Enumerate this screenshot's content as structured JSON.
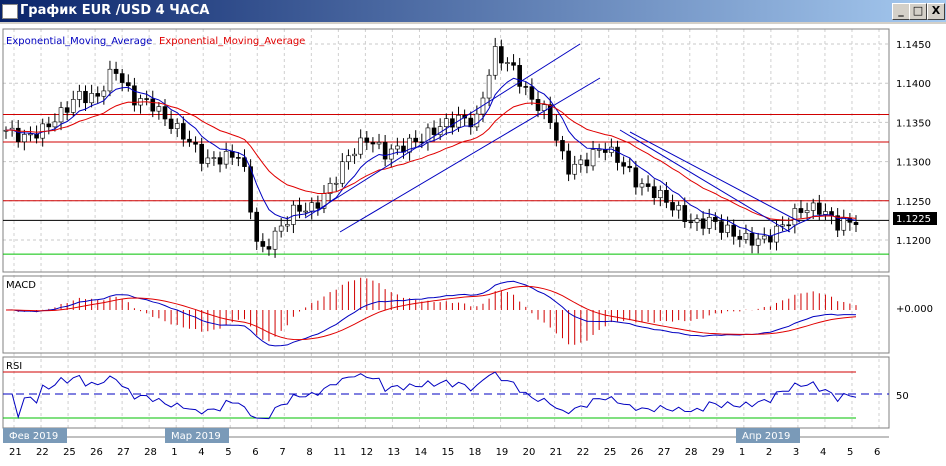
{
  "window": {
    "title": "График EUR /USD  4 ЧАСА",
    "minimize": "_",
    "maximize": "□",
    "close": "X"
  },
  "legend": {
    "ema_blue": "Exponential_Moving_Average",
    "ema_red": "Exponential_Moving_Average"
  },
  "colors": {
    "up": "#ffffff",
    "down": "#000000",
    "ema_fast": "#0000c0",
    "ema_slow": "#e00000",
    "level_red": "#d00000",
    "level_green": "#00c000"
  },
  "price_axis": {
    "labels": [
      "1.1450",
      "1.1400",
      "1.1350",
      "1.1300",
      "1.1250",
      "1.1200"
    ],
    "current": "1.1225"
  },
  "macd": {
    "label": "MACD",
    "axis_label": "+0.000"
  },
  "rsi": {
    "label": "RSI",
    "axis_label": "50"
  },
  "months": [
    "Фев 2019",
    "Мар 2019",
    "Апр 2019"
  ],
  "dates": [
    "21",
    "22",
    "25",
    "26",
    "27",
    "28",
    "1",
    "4",
    "5",
    "6",
    "7",
    "8",
    "11",
    "12",
    "13",
    "14",
    "15",
    "18",
    "19",
    "20",
    "21",
    "22",
    "25",
    "26",
    "27",
    "28",
    "29",
    "1",
    "2",
    "3",
    "4",
    "5",
    "6"
  ],
  "chart_data": {
    "type": "candlestick",
    "levels": {
      "red": [
        1.136,
        1.1325,
        1.125
      ],
      "black": 1.1225,
      "green": 1.1182
    },
    "ylim": [
      1.1172,
      1.147
    ],
    "closes": [
      1.134,
      1.133,
      1.134,
      1.136,
      1.1385,
      1.138,
      1.142,
      1.138,
      1.1375,
      1.135,
      1.133,
      1.13,
      1.1305,
      1.131,
      1.118,
      1.121,
      1.124,
      1.124,
      1.127,
      1.131,
      1.133,
      1.131,
      1.132,
      1.133,
      1.1345,
      1.1355,
      1.135,
      1.144,
      1.142,
      1.138,
      1.136,
      1.129,
      1.13,
      1.132,
      1.13,
      1.127,
      1.126,
      1.124,
      1.122,
      1.1225,
      1.121,
      1.12,
      1.12,
      1.122,
      1.124,
      1.124,
      1.122,
      1.1225
    ]
  }
}
